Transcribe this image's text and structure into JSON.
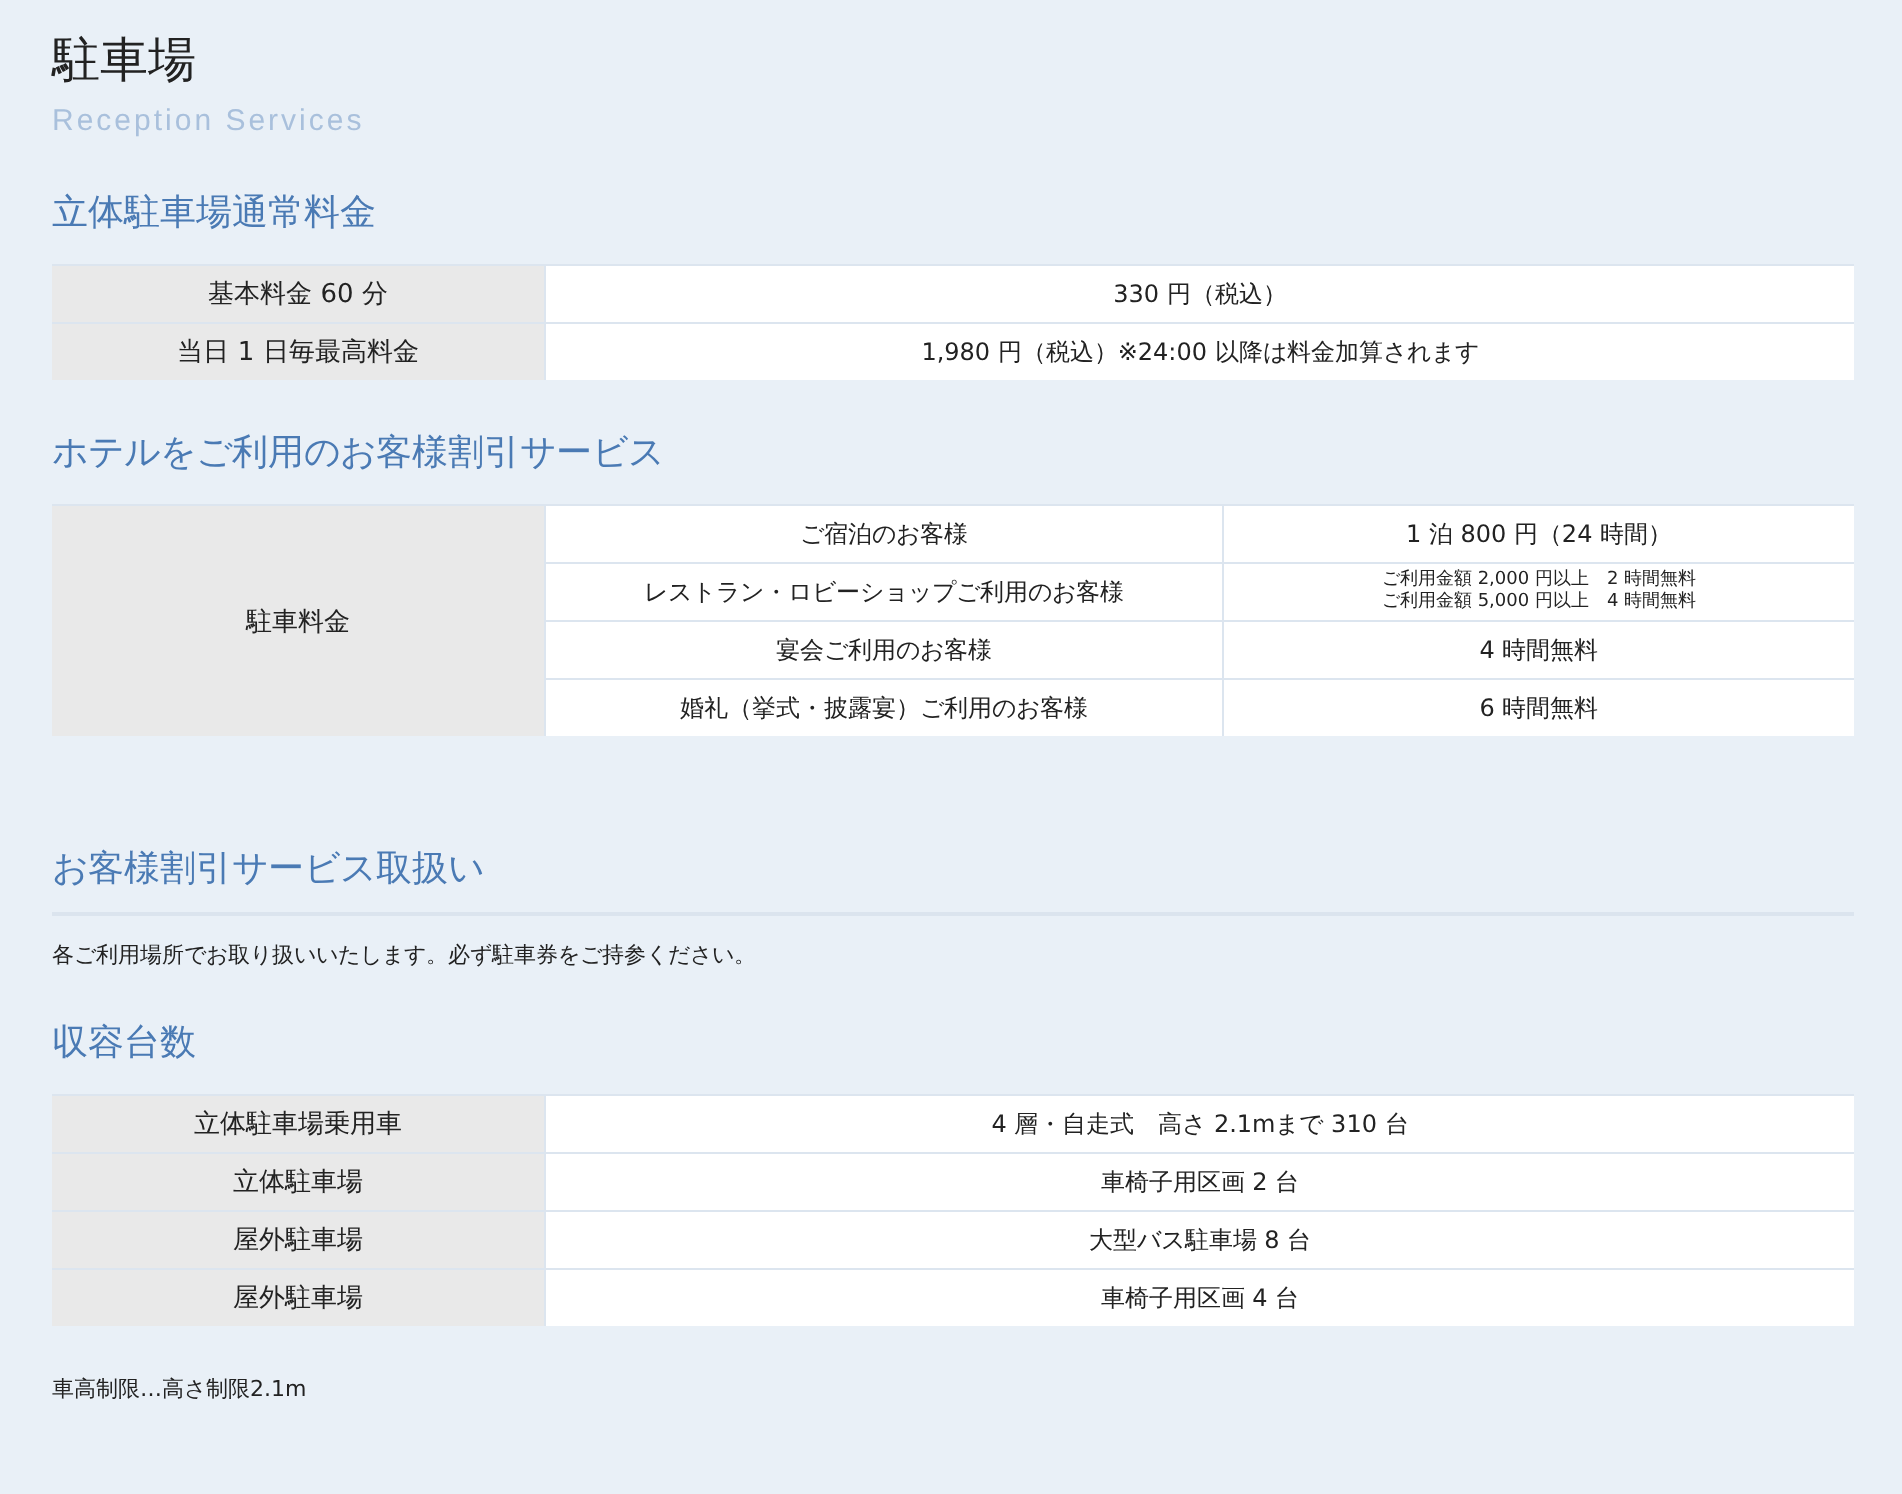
{
  "page": {
    "title": "駐車場",
    "subtitle": "Reception Services"
  },
  "sections": [
    {
      "kind": "table",
      "heading": "立体駐車場通常料金",
      "rows": [
        {
          "label": "基本料金 60 分",
          "value": "330 円（税込）"
        },
        {
          "label": "当日 1 日毎最高料金",
          "value": "1,980 円（税込）※24:00 以降は料金加算されます"
        }
      ]
    },
    {
      "kind": "grouped",
      "heading": "ホテルをご利用のお客様割引サービス",
      "label": "駐車料金",
      "rows": [
        {
          "name": "ご宿泊のお客様",
          "lines": [
            "1 泊 800 円（24 時間）"
          ]
        },
        {
          "name": "レストラン・ロビーショップご利用のお客様",
          "lines": [
            "ご利用金額 2,000 円以上　2 時間無料",
            "ご利用金額 5,000 円以上　4 時間無料"
          ]
        },
        {
          "name": "宴会ご利用のお客様",
          "lines": [
            "4 時間無料"
          ]
        },
        {
          "name": "婚礼（挙式・披露宴）ご利用のお客様",
          "lines": [
            "6 時間無料"
          ]
        }
      ]
    },
    {
      "kind": "text",
      "heading": "お客様割引サービス取扱い",
      "text": "各ご利用場所でお取り扱いいたします。必ず駐車券をご持参ください。"
    },
    {
      "kind": "table",
      "heading": "収容台数",
      "rows": [
        {
          "label": "立体駐車場乗用車",
          "value": "4 層・自走式　高さ 2.1mまで 310 台"
        },
        {
          "label": "立体駐車場",
          "value": "車椅子用区画 2 台"
        },
        {
          "label": "屋外駐車場",
          "value": "大型バス駐車場 8 台"
        },
        {
          "label": "屋外駐車場",
          "value": "車椅子用区画 4 台"
        }
      ],
      "note": "車高制限…高さ制限2.1m"
    }
  ]
}
